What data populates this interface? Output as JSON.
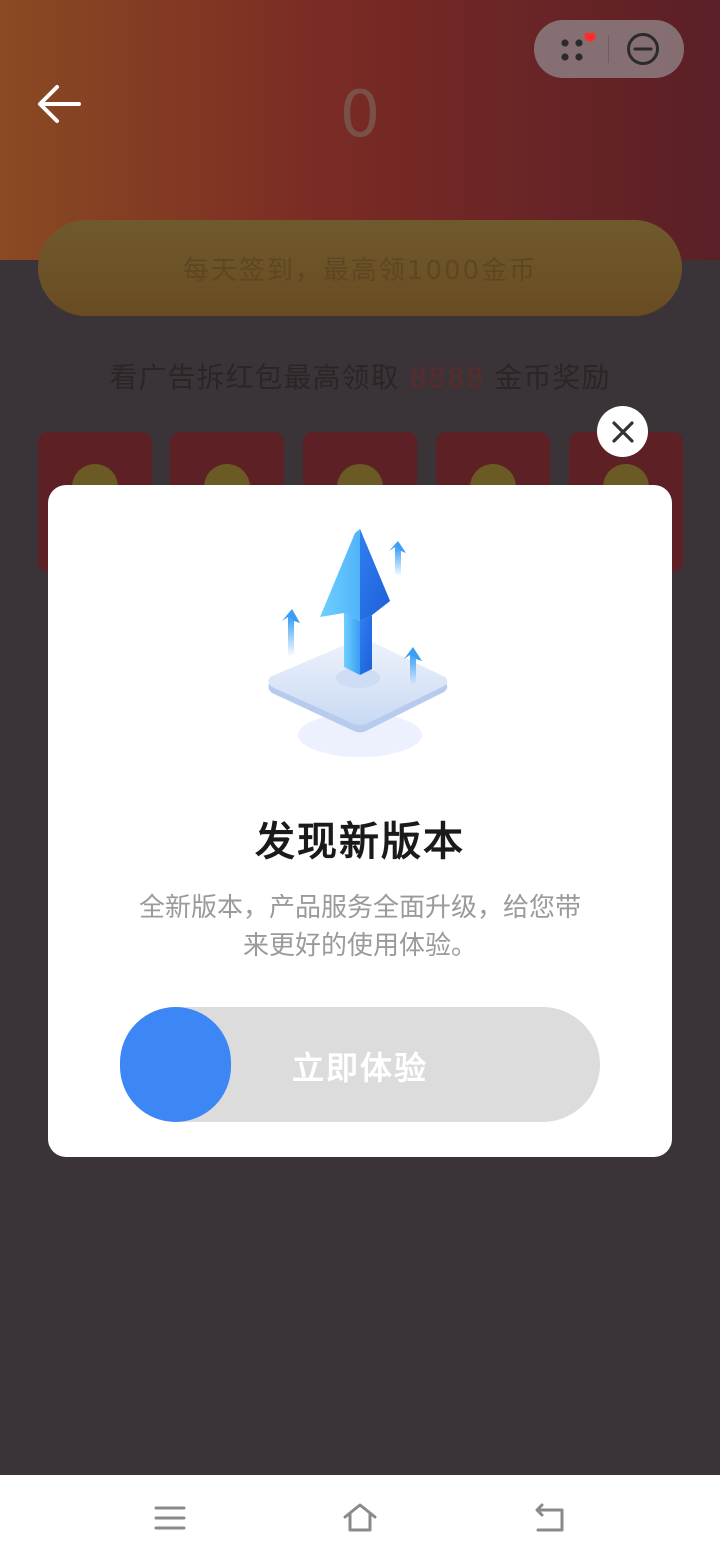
{
  "header": {
    "big_counter": "0"
  },
  "background": {
    "sign_in_text": "每天签到，最高领1000金币",
    "ad_prefix": "看广告拆红包最高领取 ",
    "ad_amount": "8888",
    "ad_suffix": " 金币奖励"
  },
  "dialog": {
    "title": "发现新版本",
    "description": "全新版本，产品服务全面升级，给您带来更好的使用体验。",
    "slider_label": "立即体验"
  },
  "colors": {
    "accent_blue": "#3d86f6",
    "notification_dot": "#ff2a2a"
  },
  "icons": {
    "back": "arrow-left-icon",
    "more": "dots-icon",
    "minimize": "minus-circle-icon",
    "close": "close-icon",
    "nav_menu": "menu-icon",
    "nav_home": "home-icon",
    "nav_back": "return-icon"
  }
}
